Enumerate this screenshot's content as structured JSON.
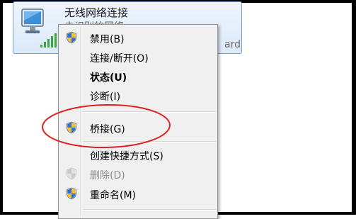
{
  "connection": {
    "name": "无线网络连接",
    "status": "未识别的网络",
    "adapter_suffix": "ard"
  },
  "context_menu": {
    "items": [
      {
        "label": "禁用(B)",
        "icon": "shield-icon",
        "bold": false,
        "disabled": false
      },
      {
        "label": "连接/断开(O)",
        "icon": "",
        "bold": false,
        "disabled": false
      },
      {
        "label": "状态(U)",
        "icon": "",
        "bold": true,
        "disabled": false
      },
      {
        "label": "诊断(I)",
        "icon": "",
        "bold": false,
        "disabled": false
      },
      {
        "label": "桥接(G)",
        "icon": "shield-icon",
        "bold": false,
        "disabled": false
      },
      {
        "label": "创建快捷方式(S)",
        "icon": "",
        "bold": false,
        "disabled": false
      },
      {
        "label": "删除(D)",
        "icon": "shield-icon",
        "bold": false,
        "disabled": true
      },
      {
        "label": "重命名(M)",
        "icon": "shield-icon",
        "bold": false,
        "disabled": false
      }
    ]
  },
  "colors": {
    "annotation": "#e02020",
    "tile_border": "#7da2ce",
    "menu_background": "#f0f0f0"
  }
}
